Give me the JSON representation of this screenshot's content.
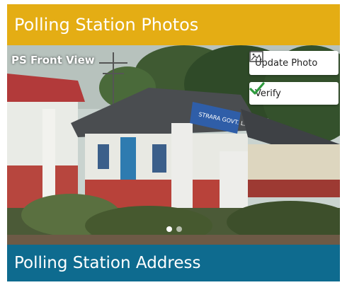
{
  "header": {
    "title": "Polling Station Photos"
  },
  "photo": {
    "label": "PS Front View",
    "sign_text": "STRARA GOVT. L.P. SCHOOL"
  },
  "actions": {
    "update_label": "Update Photo",
    "verify_label": "Verify"
  },
  "carousel": {
    "count": 2,
    "active_index": 0
  },
  "footer": {
    "title": "Polling Station Address"
  },
  "colors": {
    "header_bg": "#e4ad14",
    "footer_bg": "#0e6b8f",
    "verify_check": "#2e9b3e"
  }
}
